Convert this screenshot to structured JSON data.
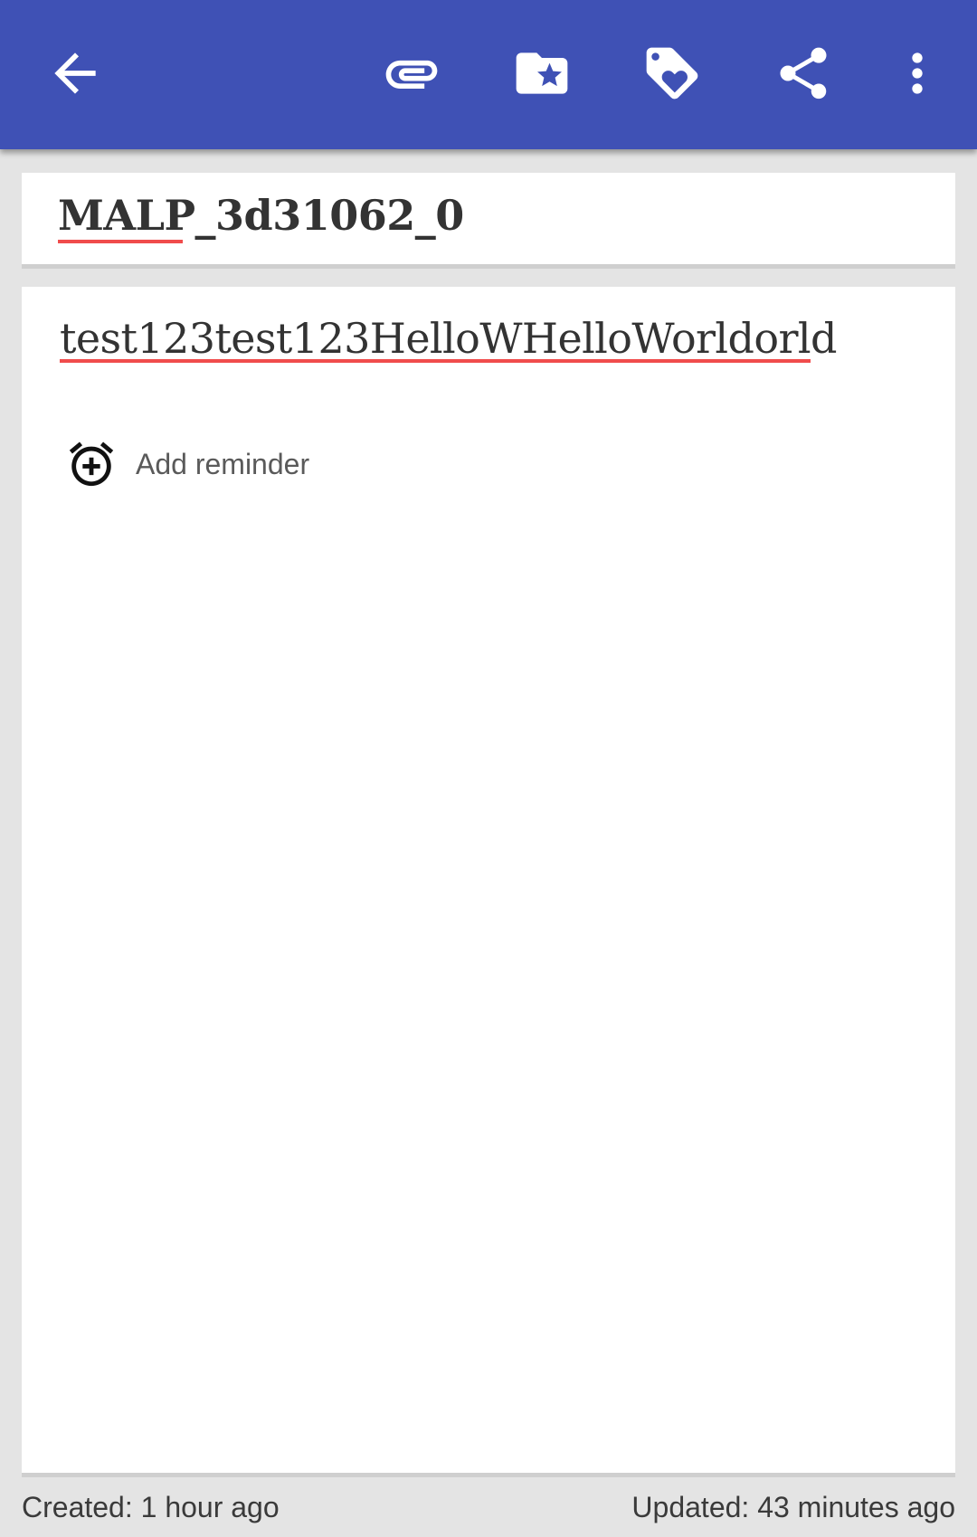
{
  "toolbar": {
    "background": "#3f51b5",
    "icons": [
      "arrow-back-icon",
      "attachment-icon",
      "folder-star-icon",
      "tag-heart-icon",
      "share-icon",
      "more-vert-icon"
    ]
  },
  "note": {
    "title": "MALP_3d31062_0",
    "content": "test123test123HelloWHelloWorldorld"
  },
  "reminder": {
    "label": "Add reminder"
  },
  "footer": {
    "created": "Created: 1 hour ago",
    "updated": "Updated: 43 minutes ago"
  }
}
